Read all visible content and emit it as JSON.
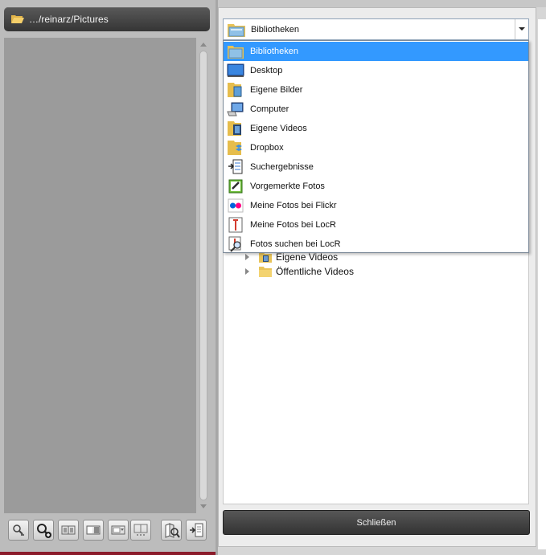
{
  "left": {
    "path": "…/reinarz/Pictures"
  },
  "toolbar": {
    "buttons": [
      {
        "icon": "zoom-out-icon"
      },
      {
        "icon": "zoom-in-icon"
      },
      {
        "icon": "compare-icon"
      },
      {
        "icon": "split-view-icon"
      },
      {
        "icon": "filmstrip-icon"
      },
      {
        "icon": "grid-view-icon"
      },
      {
        "icon": "map-search-icon"
      },
      {
        "icon": "import-icon"
      }
    ]
  },
  "combo": {
    "selected": "Bibliotheken"
  },
  "dropdown": {
    "items": [
      {
        "label": "Bibliotheken",
        "icon": "libraries-icon",
        "selected": true
      },
      {
        "label": "Desktop",
        "icon": "desktop-icon"
      },
      {
        "label": "Eigene Bilder",
        "icon": "pictures-folder-icon"
      },
      {
        "label": "Computer",
        "icon": "computer-icon"
      },
      {
        "label": "Eigene Videos",
        "icon": "videos-folder-icon"
      },
      {
        "label": "Dropbox",
        "icon": "dropbox-folder-icon"
      },
      {
        "label": "Suchergebnisse",
        "icon": "search-results-icon"
      },
      {
        "label": "Vorgemerkte Fotos",
        "icon": "bookmarked-photos-icon"
      },
      {
        "label": "Meine Fotos bei Flickr",
        "icon": "flickr-icon"
      },
      {
        "label": "Meine Fotos bei LocR",
        "icon": "locr-icon"
      },
      {
        "label": "Fotos suchen bei LocR",
        "icon": "locr-search-icon"
      }
    ]
  },
  "tree": {
    "rows": [
      {
        "label": "Eigene Videos"
      },
      {
        "label": "Öffentliche Videos"
      }
    ]
  },
  "footer": {
    "close_label": "Schließen"
  },
  "colors": {
    "selection": "#3399ff",
    "accent_line": "#8b1b2a"
  }
}
